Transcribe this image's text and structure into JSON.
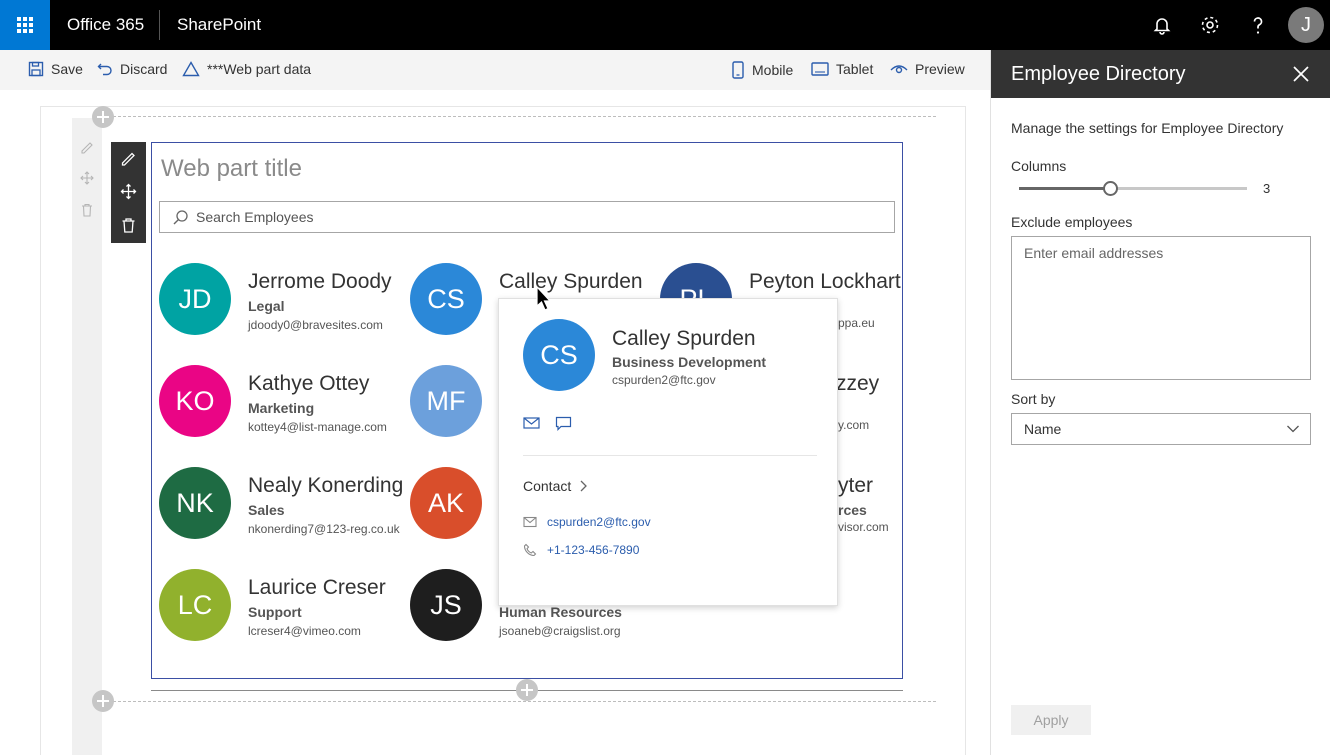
{
  "suite": {
    "brand": "Office 365",
    "app": "SharePoint",
    "user_initial": "J",
    "icons": [
      "waffle-icon",
      "bell-icon",
      "gear-icon",
      "help-icon"
    ]
  },
  "commandbar": {
    "save": "Save",
    "discard": "Discard",
    "webpart_data": "***Web part data",
    "mobile": "Mobile",
    "tablet": "Tablet",
    "preview": "Preview"
  },
  "webpart": {
    "title_placeholder": "Web part title",
    "search_placeholder": "Search Employees",
    "people": [
      {
        "initials": "JD",
        "name": "Jerrome Doody",
        "dept": "Legal",
        "email": "jdoody0@bravesites.com",
        "color": "#00a3a3"
      },
      {
        "initials": "CS",
        "name": "Calley Spurden",
        "color": "#2b88d8"
      },
      {
        "initials": "PL",
        "name": "Peyton Lockhart",
        "color": "#2a4f91"
      },
      {
        "initials": "KO",
        "name": "Kathye Ottey",
        "dept": "Marketing",
        "email": "kottey4@list-manage.com",
        "color": "#ea0585"
      },
      {
        "initials": "MF",
        "color": "#6ca0dc"
      },
      {
        "initials": "NK",
        "name": "Nealy Konerding",
        "dept": "Sales",
        "email": "nkonerding7@123-reg.co.uk",
        "color": "#1e6b43"
      },
      {
        "initials": "AK",
        "color": "#d94e2b"
      },
      {
        "initials": "LC",
        "name": "Laurice Creser",
        "dept": "Support",
        "email": "lcreser4@vimeo.com",
        "color": "#91b12d"
      },
      {
        "initials": "JS",
        "dept": "Human Resources",
        "email": "jsoaneb@craigslist.org",
        "color": "#1e1e1e"
      }
    ],
    "partial_text": {
      "peyton_email": "ppa.eu",
      "row2_name": "zzey",
      "row2_email": "y.com",
      "row3_name": "yter",
      "row3_dept": "rces",
      "row3_email": "visor.com"
    }
  },
  "hovercard": {
    "initials": "CS",
    "name": "Calley Spurden",
    "dept": "Business Development",
    "email": "cspurden2@ftc.gov",
    "contact_label": "Contact",
    "contact_email": "cspurden2@ftc.gov",
    "contact_phone": "+1-123-456-7890"
  },
  "pane": {
    "title": "Employee Directory",
    "description": "Manage the settings for Employee Directory",
    "columns_label": "Columns",
    "columns_value": "3",
    "columns_fraction": 0.4,
    "exclude_label": "Exclude employees",
    "exclude_placeholder": "Enter email addresses",
    "sort_label": "Sort by",
    "sort_value": "Name",
    "apply_label": "Apply"
  }
}
